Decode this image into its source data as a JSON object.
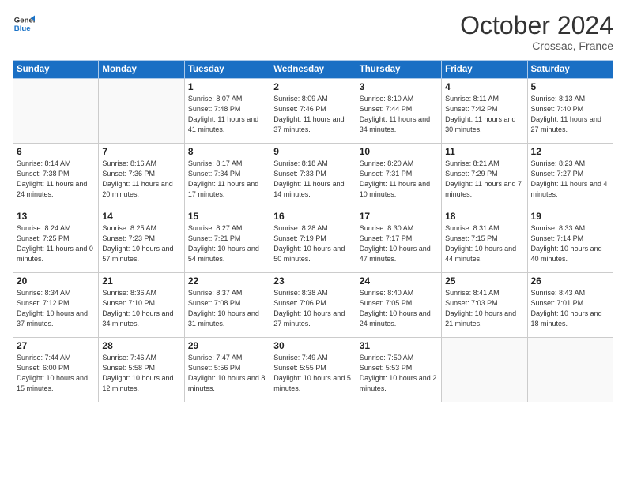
{
  "logo": {
    "line1": "General",
    "line2": "Blue"
  },
  "title": "October 2024",
  "location": "Crossac, France",
  "days_header": [
    "Sunday",
    "Monday",
    "Tuesday",
    "Wednesday",
    "Thursday",
    "Friday",
    "Saturday"
  ],
  "weeks": [
    [
      {
        "day": "",
        "info": ""
      },
      {
        "day": "",
        "info": ""
      },
      {
        "day": "1",
        "info": "Sunrise: 8:07 AM\nSunset: 7:48 PM\nDaylight: 11 hours and 41 minutes."
      },
      {
        "day": "2",
        "info": "Sunrise: 8:09 AM\nSunset: 7:46 PM\nDaylight: 11 hours and 37 minutes."
      },
      {
        "day": "3",
        "info": "Sunrise: 8:10 AM\nSunset: 7:44 PM\nDaylight: 11 hours and 34 minutes."
      },
      {
        "day": "4",
        "info": "Sunrise: 8:11 AM\nSunset: 7:42 PM\nDaylight: 11 hours and 30 minutes."
      },
      {
        "day": "5",
        "info": "Sunrise: 8:13 AM\nSunset: 7:40 PM\nDaylight: 11 hours and 27 minutes."
      }
    ],
    [
      {
        "day": "6",
        "info": "Sunrise: 8:14 AM\nSunset: 7:38 PM\nDaylight: 11 hours and 24 minutes."
      },
      {
        "day": "7",
        "info": "Sunrise: 8:16 AM\nSunset: 7:36 PM\nDaylight: 11 hours and 20 minutes."
      },
      {
        "day": "8",
        "info": "Sunrise: 8:17 AM\nSunset: 7:34 PM\nDaylight: 11 hours and 17 minutes."
      },
      {
        "day": "9",
        "info": "Sunrise: 8:18 AM\nSunset: 7:33 PM\nDaylight: 11 hours and 14 minutes."
      },
      {
        "day": "10",
        "info": "Sunrise: 8:20 AM\nSunset: 7:31 PM\nDaylight: 11 hours and 10 minutes."
      },
      {
        "day": "11",
        "info": "Sunrise: 8:21 AM\nSunset: 7:29 PM\nDaylight: 11 hours and 7 minutes."
      },
      {
        "day": "12",
        "info": "Sunrise: 8:23 AM\nSunset: 7:27 PM\nDaylight: 11 hours and 4 minutes."
      }
    ],
    [
      {
        "day": "13",
        "info": "Sunrise: 8:24 AM\nSunset: 7:25 PM\nDaylight: 11 hours and 0 minutes."
      },
      {
        "day": "14",
        "info": "Sunrise: 8:25 AM\nSunset: 7:23 PM\nDaylight: 10 hours and 57 minutes."
      },
      {
        "day": "15",
        "info": "Sunrise: 8:27 AM\nSunset: 7:21 PM\nDaylight: 10 hours and 54 minutes."
      },
      {
        "day": "16",
        "info": "Sunrise: 8:28 AM\nSunset: 7:19 PM\nDaylight: 10 hours and 50 minutes."
      },
      {
        "day": "17",
        "info": "Sunrise: 8:30 AM\nSunset: 7:17 PM\nDaylight: 10 hours and 47 minutes."
      },
      {
        "day": "18",
        "info": "Sunrise: 8:31 AM\nSunset: 7:15 PM\nDaylight: 10 hours and 44 minutes."
      },
      {
        "day": "19",
        "info": "Sunrise: 8:33 AM\nSunset: 7:14 PM\nDaylight: 10 hours and 40 minutes."
      }
    ],
    [
      {
        "day": "20",
        "info": "Sunrise: 8:34 AM\nSunset: 7:12 PM\nDaylight: 10 hours and 37 minutes."
      },
      {
        "day": "21",
        "info": "Sunrise: 8:36 AM\nSunset: 7:10 PM\nDaylight: 10 hours and 34 minutes."
      },
      {
        "day": "22",
        "info": "Sunrise: 8:37 AM\nSunset: 7:08 PM\nDaylight: 10 hours and 31 minutes."
      },
      {
        "day": "23",
        "info": "Sunrise: 8:38 AM\nSunset: 7:06 PM\nDaylight: 10 hours and 27 minutes."
      },
      {
        "day": "24",
        "info": "Sunrise: 8:40 AM\nSunset: 7:05 PM\nDaylight: 10 hours and 24 minutes."
      },
      {
        "day": "25",
        "info": "Sunrise: 8:41 AM\nSunset: 7:03 PM\nDaylight: 10 hours and 21 minutes."
      },
      {
        "day": "26",
        "info": "Sunrise: 8:43 AM\nSunset: 7:01 PM\nDaylight: 10 hours and 18 minutes."
      }
    ],
    [
      {
        "day": "27",
        "info": "Sunrise: 7:44 AM\nSunset: 6:00 PM\nDaylight: 10 hours and 15 minutes."
      },
      {
        "day": "28",
        "info": "Sunrise: 7:46 AM\nSunset: 5:58 PM\nDaylight: 10 hours and 12 minutes."
      },
      {
        "day": "29",
        "info": "Sunrise: 7:47 AM\nSunset: 5:56 PM\nDaylight: 10 hours and 8 minutes."
      },
      {
        "day": "30",
        "info": "Sunrise: 7:49 AM\nSunset: 5:55 PM\nDaylight: 10 hours and 5 minutes."
      },
      {
        "day": "31",
        "info": "Sunrise: 7:50 AM\nSunset: 5:53 PM\nDaylight: 10 hours and 2 minutes."
      },
      {
        "day": "",
        "info": ""
      },
      {
        "day": "",
        "info": ""
      }
    ]
  ]
}
